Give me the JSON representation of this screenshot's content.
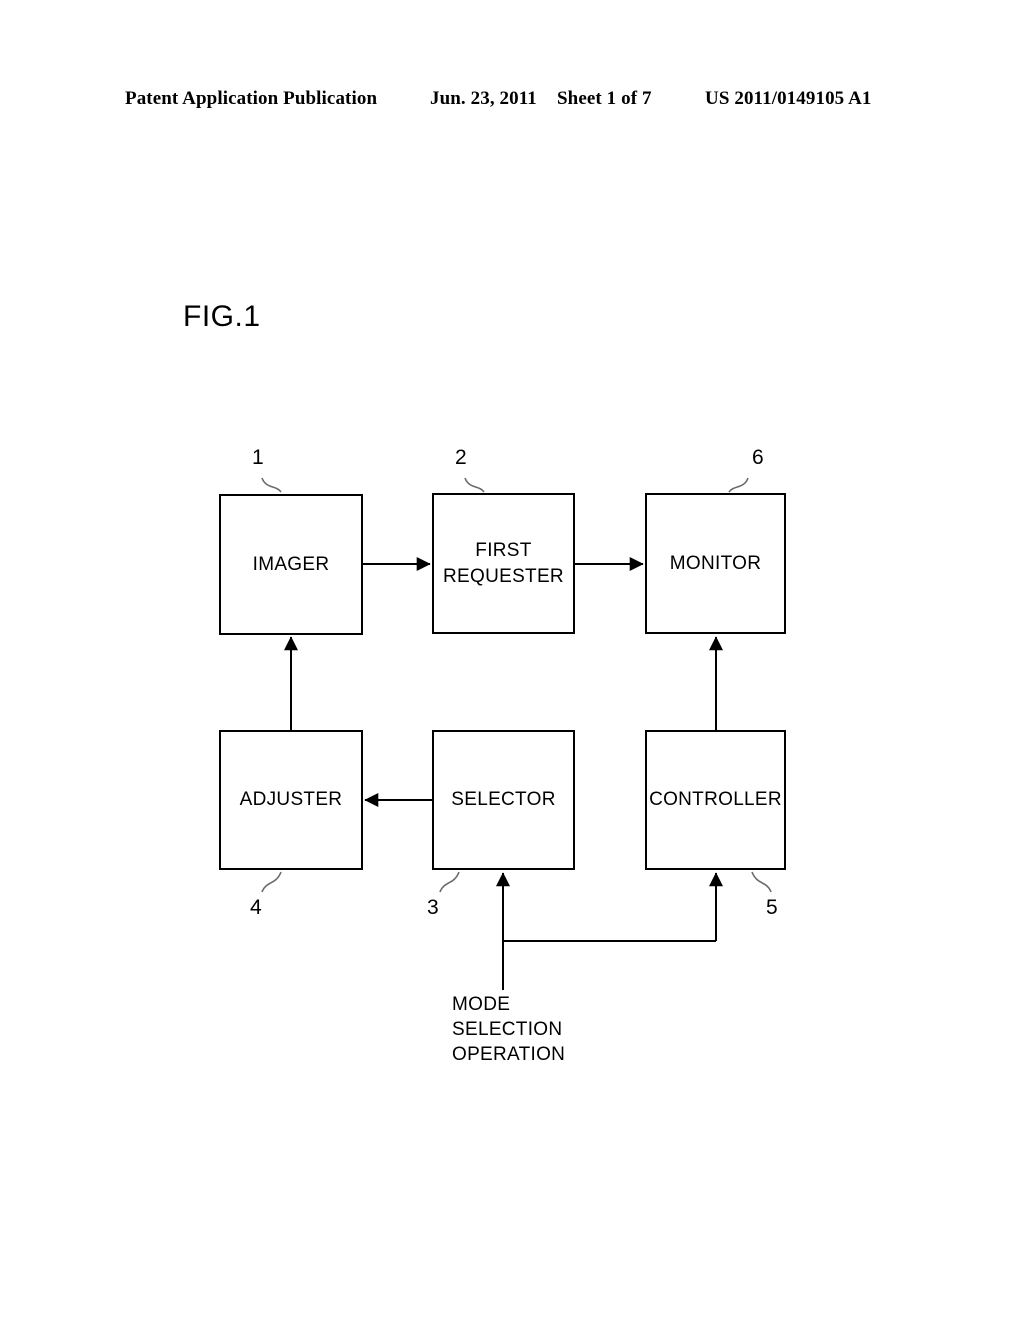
{
  "header": {
    "publication": "Patent Application Publication",
    "date": "Jun. 23, 2011",
    "sheet": "Sheet 1 of 7",
    "patent_number": "US 2011/0149105 A1"
  },
  "figure": {
    "title": "FIG.1",
    "caption": "MODE\nSELECTION\nOPERATION",
    "blocks": [
      {
        "id": "imager",
        "label": "IMAGER",
        "ref": "1"
      },
      {
        "id": "requester",
        "label": "FIRST\nREQUESTER",
        "ref": "2"
      },
      {
        "id": "monitor",
        "label": "MONITOR",
        "ref": "6"
      },
      {
        "id": "adjuster",
        "label": "ADJUSTER",
        "ref": "4"
      },
      {
        "id": "selector",
        "label": "SELECTOR",
        "ref": "3"
      },
      {
        "id": "controller",
        "label": "CONTROLLER",
        "ref": "5"
      }
    ],
    "connections": [
      {
        "from": "imager",
        "to": "requester",
        "direction": "right"
      },
      {
        "from": "requester",
        "to": "monitor",
        "direction": "right"
      },
      {
        "from": "adjuster",
        "to": "imager",
        "direction": "up"
      },
      {
        "from": "controller",
        "to": "monitor",
        "direction": "up"
      },
      {
        "from": "selector",
        "to": "adjuster",
        "direction": "left"
      },
      {
        "from": "mode-selection-operation",
        "to": "selector",
        "direction": "up"
      },
      {
        "from": "mode-selection-operation",
        "to": "controller",
        "direction": "up"
      }
    ],
    "line_color": "#000000",
    "background_color": "#ffffff"
  }
}
